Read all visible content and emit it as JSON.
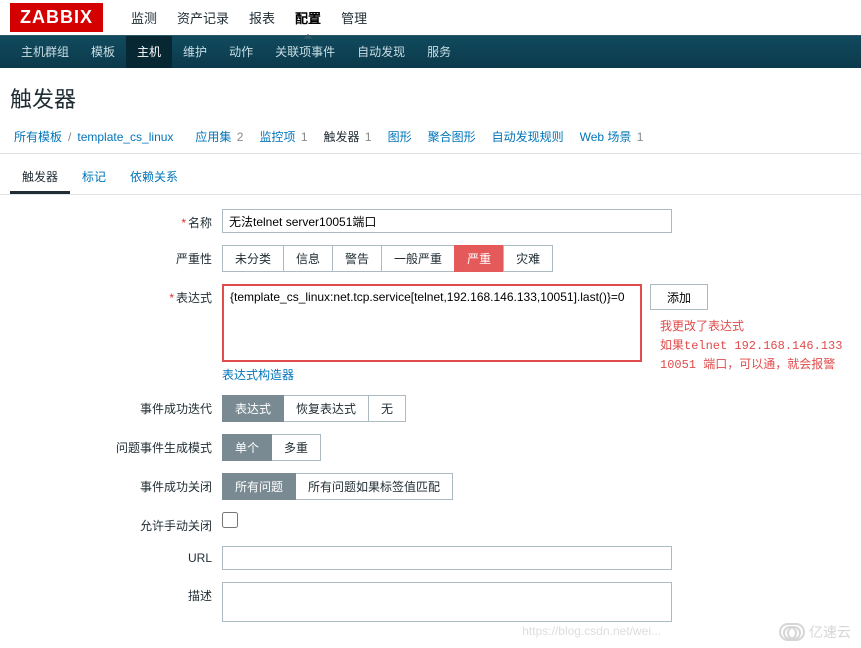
{
  "logo": "ZABBIX",
  "topnav": [
    "监测",
    "资产记录",
    "报表",
    "配置",
    "管理"
  ],
  "topnav_active": 3,
  "subnav": [
    "主机群组",
    "模板",
    "主机",
    "维护",
    "动作",
    "关联项事件",
    "自动发现",
    "服务"
  ],
  "subnav_active": 2,
  "page_title": "触发器",
  "breadcrumb": {
    "all_templates": "所有模板",
    "template": "template_cs_linux"
  },
  "context_tabs": [
    {
      "label": "应用集",
      "count": "2"
    },
    {
      "label": "监控项",
      "count": "1"
    },
    {
      "label": "触发器",
      "count": "1",
      "active": true
    },
    {
      "label": "图形",
      "count": ""
    },
    {
      "label": "聚合图形",
      "count": ""
    },
    {
      "label": "自动发现规则",
      "count": ""
    },
    {
      "label": "Web 场景",
      "count": "1"
    }
  ],
  "inner_tabs": [
    "触发器",
    "标记",
    "依赖关系"
  ],
  "inner_active": 0,
  "form": {
    "name_label": "名称",
    "name_value": "无法telnet server10051端口",
    "severity_label": "严重性",
    "severity_opts": [
      "未分类",
      "信息",
      "警告",
      "一般严重",
      "严重",
      "灾难"
    ],
    "severity_sel": 4,
    "expr_label": "表达式",
    "expr_value": "{template_cs_linux:net.tcp.service[telnet,192.168.146.133,10051].last()}=0",
    "add_btn": "添加",
    "expr_builder": "表达式构造器",
    "event_ok_iter_label": "事件成功迭代",
    "event_ok_iter_opts": [
      "表达式",
      "恢复表达式",
      "无"
    ],
    "event_ok_iter_sel": 0,
    "problem_gen_label": "问题事件生成模式",
    "problem_gen_opts": [
      "单个",
      "多重"
    ],
    "problem_gen_sel": 0,
    "event_ok_close_label": "事件成功关闭",
    "event_ok_close_opts": [
      "所有问题",
      "所有问题如果标签值匹配"
    ],
    "event_ok_close_sel": 0,
    "allow_manual_label": "允许手动关闭",
    "url_label": "URL",
    "url_value": "",
    "desc_label": "描述",
    "desc_value": ""
  },
  "annotation": {
    "l1": "我更改了表达式",
    "l2": "如果telnet 192.168.146.133",
    "l3": "10051 端口，可以通，就会报警"
  },
  "watermark": "亿速云",
  "watermark2": "https://blog.csdn.net/wei..."
}
